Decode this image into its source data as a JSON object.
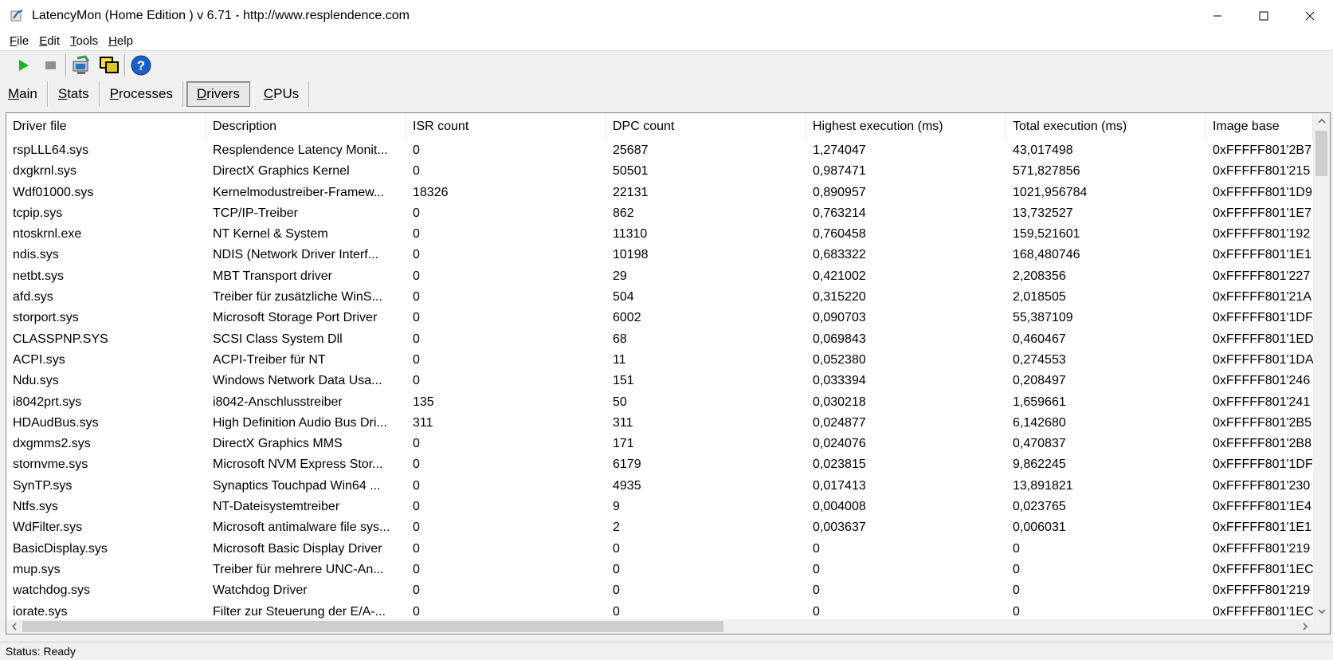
{
  "window": {
    "title": "LatencyMon  (Home Edition )  v 6.71 - http://www.resplendence.com"
  },
  "menu": {
    "items": [
      {
        "label": "File",
        "accel": "F",
        "rest": "ile"
      },
      {
        "label": "Edit",
        "accel": "E",
        "rest": "dit"
      },
      {
        "label": "Tools",
        "accel": "T",
        "rest": "ools"
      },
      {
        "label": "Help",
        "accel": "H",
        "rest": "elp"
      }
    ]
  },
  "toolbar": {
    "icons": [
      "play-icon",
      "stop-icon",
      "monitor-icon",
      "windows-icon",
      "help-icon"
    ],
    "colors": {
      "play": "#16b81d",
      "stop": "#8f8f8f",
      "help": "#1a5fc8"
    }
  },
  "tabs": [
    {
      "accel": "M",
      "rest": "ain",
      "active": false
    },
    {
      "accel": "S",
      "rest": "tats",
      "active": false
    },
    {
      "accel": "P",
      "rest": "rocesses",
      "active": false
    },
    {
      "accel": "D",
      "rest": "rivers",
      "active": true
    },
    {
      "accel": "C",
      "rest": "PUs",
      "active": false
    }
  ],
  "table": {
    "columns": [
      "Driver file",
      "Description",
      "ISR count",
      "DPC count",
      "Highest execution (ms)",
      "Total execution (ms)",
      "Image base"
    ],
    "rows": [
      [
        "rspLLL64.sys",
        "Resplendence Latency Monit...",
        "0",
        "25687",
        "1,274047",
        "43,017498",
        "0xFFFFF801'2B7"
      ],
      [
        "dxgkrnl.sys",
        "DirectX Graphics Kernel",
        "0",
        "50501",
        "0,987471",
        "571,827856",
        "0xFFFFF801'215"
      ],
      [
        "Wdf01000.sys",
        "Kernelmodustreiber-Framew...",
        "18326",
        "22131",
        "0,890957",
        "1021,956784",
        "0xFFFFF801'1D9"
      ],
      [
        "tcpip.sys",
        "TCP/IP-Treiber",
        "0",
        "862",
        "0,763214",
        "13,732527",
        "0xFFFFF801'1E7"
      ],
      [
        "ntoskrnl.exe",
        "NT Kernel & System",
        "0",
        "11310",
        "0,760458",
        "159,521601",
        "0xFFFFF801'192"
      ],
      [
        "ndis.sys",
        "NDIS (Network Driver Interf...",
        "0",
        "10198",
        "0,683322",
        "168,480746",
        "0xFFFFF801'1E1"
      ],
      [
        "netbt.sys",
        "MBT Transport driver",
        "0",
        "29",
        "0,421002",
        "2,208356",
        "0xFFFFF801'227"
      ],
      [
        "afd.sys",
        "Treiber für zusätzliche WinS...",
        "0",
        "504",
        "0,315220",
        "2,018505",
        "0xFFFFF801'21A"
      ],
      [
        "storport.sys",
        "Microsoft Storage Port Driver",
        "0",
        "6002",
        "0,090703",
        "55,387109",
        "0xFFFFF801'1DF"
      ],
      [
        "CLASSPNP.SYS",
        "SCSI Class System Dll",
        "0",
        "68",
        "0,069843",
        "0,460467",
        "0xFFFFF801'1ED"
      ],
      [
        "ACPI.sys",
        "ACPI-Treiber für NT",
        "0",
        "11",
        "0,052380",
        "0,274553",
        "0xFFFFF801'1DA"
      ],
      [
        "Ndu.sys",
        "Windows Network Data Usa...",
        "0",
        "151",
        "0,033394",
        "0,208497",
        "0xFFFFF801'246"
      ],
      [
        "i8042prt.sys",
        "i8042-Anschlusstreiber",
        "135",
        "50",
        "0,030218",
        "1,659661",
        "0xFFFFF801'241"
      ],
      [
        "HDAudBus.sys",
        "High Definition Audio Bus Dri...",
        "311",
        "311",
        "0,024877",
        "6,142680",
        "0xFFFFF801'2B5"
      ],
      [
        "dxgmms2.sys",
        "DirectX Graphics MMS",
        "0",
        "171",
        "0,024076",
        "0,470837",
        "0xFFFFF801'2B8"
      ],
      [
        "stornvme.sys",
        "Microsoft NVM Express Stor...",
        "0",
        "6179",
        "0,023815",
        "9,862245",
        "0xFFFFF801'1DF"
      ],
      [
        "SynTP.sys",
        "Synaptics Touchpad Win64 ...",
        "0",
        "4935",
        "0,017413",
        "13,891821",
        "0xFFFFF801'230"
      ],
      [
        "Ntfs.sys",
        "NT-Dateisystemtreiber",
        "0",
        "9",
        "0,004008",
        "0,023765",
        "0xFFFFF801'1E4"
      ],
      [
        "WdFilter.sys",
        "Microsoft antimalware file sys...",
        "0",
        "2",
        "0,003637",
        "0,006031",
        "0xFFFFF801'1E1"
      ],
      [
        "BasicDisplay.sys",
        "Microsoft Basic Display Driver",
        "0",
        "0",
        "0",
        "0",
        "0xFFFFF801'219"
      ],
      [
        "mup.sys",
        "Treiber für mehrere UNC-An...",
        "0",
        "0",
        "0",
        "0",
        "0xFFFFF801'1EC"
      ],
      [
        "watchdog.sys",
        "Watchdog Driver",
        "0",
        "0",
        "0",
        "0",
        "0xFFFFF801'219"
      ],
      [
        "iorate.sys",
        "Filter zur Steuerung der E/A-...",
        "0",
        "0",
        "0",
        "0",
        "0xFFFFF801'1EC"
      ]
    ]
  },
  "status": {
    "text": "Status: Ready"
  }
}
